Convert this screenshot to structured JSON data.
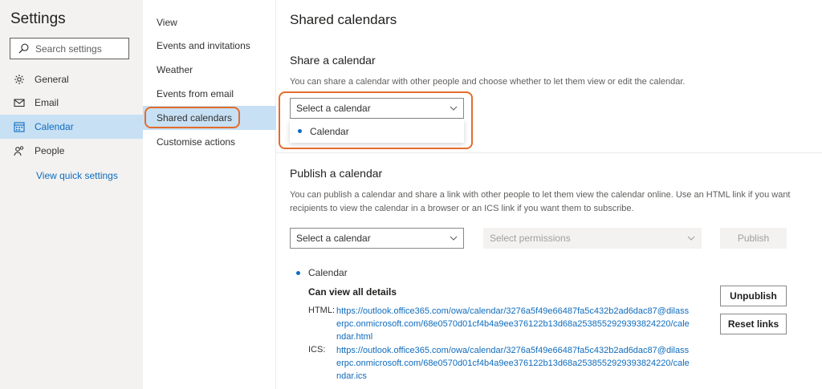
{
  "nav": {
    "title": "Settings",
    "search_placeholder": "Search settings",
    "items": [
      {
        "label": "General",
        "icon": "gear-icon"
      },
      {
        "label": "Email",
        "icon": "mail-icon"
      },
      {
        "label": "Calendar",
        "icon": "calendar-icon",
        "active": true
      },
      {
        "label": "People",
        "icon": "people-icon"
      }
    ],
    "quick_link": "View quick settings"
  },
  "subnav": {
    "items": [
      {
        "label": "View"
      },
      {
        "label": "Events and invitations"
      },
      {
        "label": "Weather"
      },
      {
        "label": "Events from email"
      },
      {
        "label": "Shared calendars",
        "active": true
      },
      {
        "label": "Customise actions"
      }
    ]
  },
  "main": {
    "title": "Shared calendars",
    "share": {
      "heading": "Share a calendar",
      "description": "You can share a calendar with other people and choose whether to let them view or edit the calendar.",
      "select_placeholder": "Select a calendar",
      "dropdown_option": "Calendar"
    },
    "publish": {
      "heading": "Publish a calendar",
      "description": "You can publish a calendar and share a link with other people to let them view the calendar online. Use an HTML link if you want recipients to view the calendar in a browser or an ICS link if you want them to subscribe.",
      "select_placeholder": "Select a calendar",
      "permissions_placeholder": "Select permissions",
      "publish_label": "Publish",
      "calendar_name": "Calendar",
      "permission_text": "Can view all details",
      "html_label": "HTML:",
      "html_url": "https://outlook.office365.com/owa/calendar/3276a5f49e66487fa5c432b2ad6dac87@dilasserpc.onmicrosoft.com/68e0570d01cf4b4a9ee376122b13d68a2538552929393824220/calendar.html",
      "ics_label": "ICS:",
      "ics_url": "https://outlook.office365.com/owa/calendar/3276a5f49e66487fa5c432b2ad6dac87@dilasserpc.onmicrosoft.com/68e0570d01cf4b4a9ee376122b13d68a2538552929393824220/calendar.ics",
      "unpublish_label": "Unpublish",
      "reset_label": "Reset links"
    }
  },
  "colors": {
    "accent": "#0f6cbd",
    "highlight_ring": "#e36c2d",
    "selected_bg": "#c7e0f4",
    "nav_bg": "#f3f2f1"
  }
}
